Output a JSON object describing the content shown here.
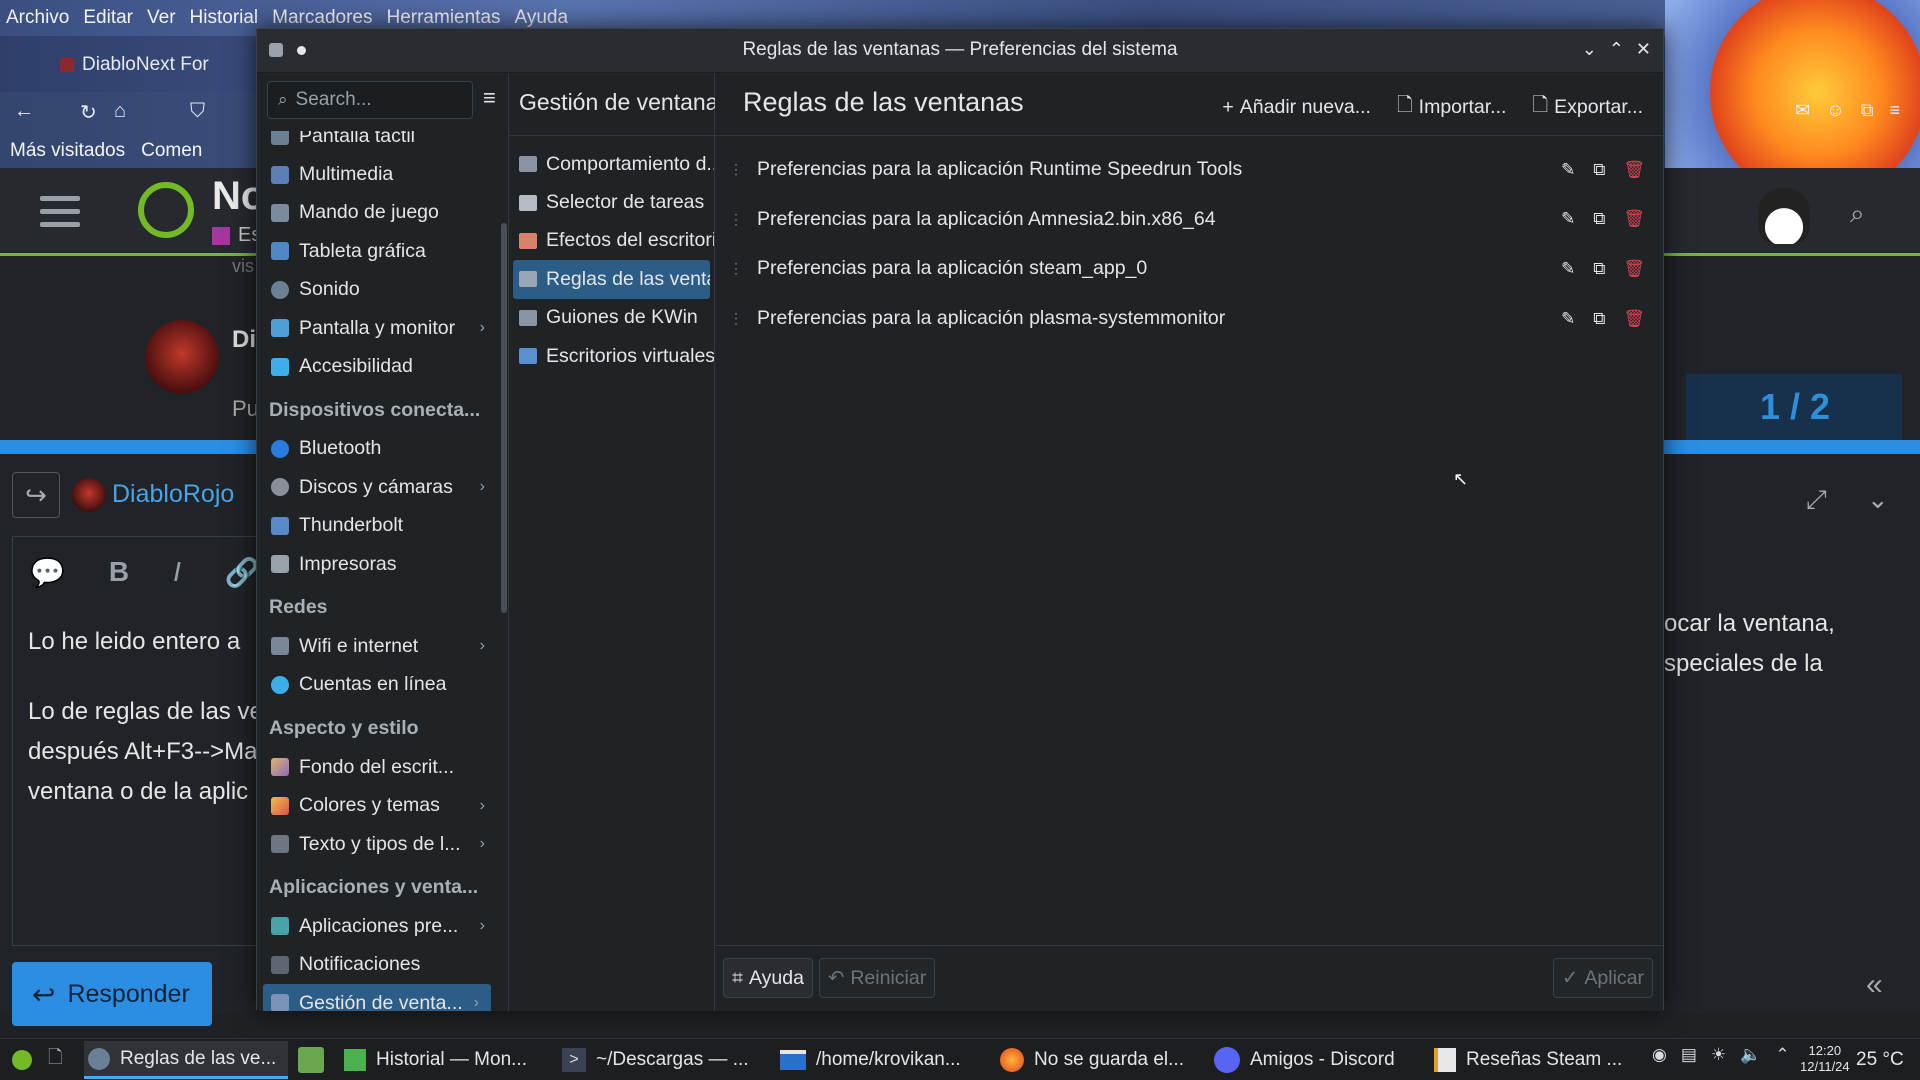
{
  "firefox": {
    "menu": [
      "Archivo",
      "Editar",
      "Ver",
      "Historial",
      "Marcadores",
      "Herramientas",
      "Ayuda"
    ],
    "tab_title": "DiabloNext For",
    "bookmarks": [
      "Más visitados",
      "Comen"
    ]
  },
  "forum": {
    "site_title": "No",
    "site_sub": "Es",
    "post_author_partial": "Di",
    "post_pu": "Pu",
    "post_vi": "vis",
    "counter": "1 / 2",
    "reply_user": "DiabloRojo",
    "editor_line1": "Lo he leido entero a",
    "editor_line2": "Lo de reglas de las ve",
    "editor_line3": "después Alt+F3-->Ma",
    "editor_line4": "ventana o de la aplic",
    "right_line1": "ocar la ventana,",
    "right_line2": "speciales de la",
    "reply_button": "Responder"
  },
  "window": {
    "title": "Reglas de las ventanas — Preferencias del sistema"
  },
  "sidebar": {
    "search_placeholder": "Search...",
    "partial_top": "Pantalla táctil",
    "items": [
      {
        "label": "Multimedia",
        "color": "#5d7fb5"
      },
      {
        "label": "Mando de juego",
        "color": "#7b8a9c"
      },
      {
        "label": "Tableta gráfica",
        "color": "#4f86c6"
      },
      {
        "label": "Sonido",
        "color": "#6b7f95"
      },
      {
        "label": "Pantalla y monitor",
        "color": "#4d9fd6"
      },
      {
        "label": "Accesibilidad",
        "color": "#3daee9"
      }
    ],
    "heading_devices": "Dispositivos conecta...",
    "devices": [
      {
        "label": "Bluetooth",
        "color": "#2a7bde"
      },
      {
        "label": "Discos y cámaras",
        "color": "#8a9099"
      },
      {
        "label": "Thunderbolt",
        "color": "#5a89c9"
      },
      {
        "label": "Impresoras",
        "color": "#9aa2ab"
      }
    ],
    "heading_networks": "Redes",
    "networks": [
      {
        "label": "Wifi e internet",
        "color": "#7b8797"
      },
      {
        "label": "Cuentas en línea",
        "color": "#3daee9"
      }
    ],
    "heading_appearance": "Aspecto y estilo",
    "appearance": [
      {
        "label": "Fondo del escrit...",
        "color": "#c7a36b"
      },
      {
        "label": "Colores y temas",
        "color": "#d96a5a"
      },
      {
        "label": "Texto y tipos de l...",
        "color": "#6e7781"
      }
    ],
    "heading_apps": "Aplicaciones y venta...",
    "apps": [
      {
        "label": "Aplicaciones pre...",
        "color": "#4aa3a8"
      },
      {
        "label": "Notificaciones",
        "color": "#5c6670"
      },
      {
        "label": "Gestión de venta...",
        "color": "#7b93b5"
      }
    ]
  },
  "submenu": {
    "title": "Gestión de ventanas",
    "items": [
      {
        "label": "Comportamiento d...",
        "color": "#8a95a3"
      },
      {
        "label": "Selector de tareas",
        "color": "#b5bcc5"
      },
      {
        "label": "Efectos del escritorio",
        "color": "#d9826a"
      },
      {
        "label": "Reglas de las venta...",
        "color": "#9aa6b5"
      },
      {
        "label": "Guiones de KWin",
        "color": "#8a95a3"
      },
      {
        "label": "Escritorios virtuales",
        "color": "#5a8fd0"
      }
    ]
  },
  "content": {
    "title": "Reglas de las ventanas",
    "add_label": "Añadir nueva...",
    "import_label": "Importar...",
    "export_label": "Exportar...",
    "rules": [
      "Preferencias para la aplicación Runtime Speedrun Tools",
      "Preferencias para la aplicación Amnesia2.bin.x86_64",
      "Preferencias para la aplicación steam_app_0",
      "Preferencias para la aplicación plasma-systemmonitor"
    ],
    "help_label": "Ayuda",
    "reset_label": "Reiniciar",
    "apply_label": "Aplicar"
  },
  "taskbar": {
    "tasks": [
      {
        "label": "Reglas de las ve...",
        "active": true
      },
      {
        "label": "Historial — Mon...",
        "active": false
      },
      {
        "label": "~/Descargas — ...",
        "active": false
      },
      {
        "label": "/home/krovikan...",
        "active": false
      },
      {
        "label": "No se guarda el...",
        "active": false
      },
      {
        "label": "Amigos - Discord",
        "active": false
      },
      {
        "label": "Reseñas Steam ...",
        "active": false
      }
    ],
    "time": "12:20",
    "date": "12/11/24",
    "temperature": "25 °C"
  },
  "colors": {
    "accent": "#2c5d87",
    "delete": "#da4453",
    "forum_green": "#73ba25",
    "link_blue": "#2b8ee3"
  }
}
